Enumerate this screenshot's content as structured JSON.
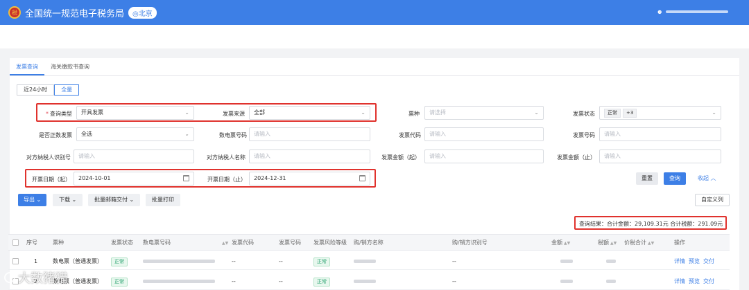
{
  "header": {
    "logo_label": "税",
    "title": "全国统一规范电子税务局",
    "region": "◎北京",
    "user_icon": "user-icon"
  },
  "tabs": [
    {
      "label": "发票查询",
      "active": true
    },
    {
      "label": "海关缴款书查询",
      "active": false
    }
  ],
  "time_range": [
    {
      "label": "近24小时",
      "active": false
    },
    {
      "label": "全量",
      "active": true
    }
  ],
  "form": {
    "query_type": {
      "label": "查询类型",
      "value": "开具发票"
    },
    "invoice_source": {
      "label": "发票来源",
      "value": "全部"
    },
    "ticket_kind": {
      "label": "票种",
      "placeholder": "请选择"
    },
    "invoice_status": {
      "label": "发票状态",
      "tag": "正常",
      "more": "+3"
    },
    "is_positive": {
      "label": "是否正数发票",
      "value": "全选"
    },
    "digital_invoice_no": {
      "label": "数电票号码",
      "placeholder": "请输入"
    },
    "invoice_code": {
      "label": "发票代码",
      "placeholder": "请输入"
    },
    "invoice_no": {
      "label": "发票号码",
      "placeholder": "请输入"
    },
    "counterparty_id": {
      "label": "对方纳税人识别号",
      "placeholder": "请输入"
    },
    "counterparty_name": {
      "label": "对方纳税人名称",
      "placeholder": "请输入"
    },
    "amount_from": {
      "label": "发票金额（起）",
      "placeholder": "请输入"
    },
    "amount_to": {
      "label": "发票金额（止）",
      "placeholder": "请输入"
    },
    "date_from": {
      "label": "开票日期（起）",
      "value": "2024-10-01"
    },
    "date_to": {
      "label": "开票日期（止）",
      "value": "2024-12-31"
    }
  },
  "actions": {
    "reset": "重置",
    "query": "查询",
    "collapse": "收起 ︿"
  },
  "toolbar": {
    "export": "导出 ⌄",
    "download": "下载 ⌄",
    "batch_mail": "批量邮箱交付 ⌄",
    "batch_print": "批量打印",
    "custom_columns": "自定义列"
  },
  "summary": {
    "text": "查询结果：合计金额：29,109.31元   合计税额：291.09元"
  },
  "table": {
    "headers": {
      "seq": "序号",
      "kind": "票种",
      "status": "发票状态",
      "digital_no": "数电票号码",
      "code": "发票代码",
      "number": "发票号码",
      "risk": "发票风险等级",
      "party_name": "购/销方名称",
      "party_id": "购/销方识别号",
      "amount": "金额",
      "tax": "税额",
      "total": "价税合计",
      "ops": "操作"
    },
    "rows": [
      {
        "seq": "1",
        "kind": "数电票（普通发票）",
        "status": "正常",
        "code": "--",
        "number": "--",
        "risk": "正常",
        "party_id": "--",
        "ops": [
          "详情",
          "预览",
          "交付"
        ]
      },
      {
        "seq": "2",
        "kind": "数电票（普通发票）",
        "status": "正常",
        "code": "--",
        "number": "--",
        "risk": "正常",
        "party_id": "--",
        "ops": [
          "详情",
          "预览",
          "交付"
        ]
      }
    ]
  },
  "watermark": "大数猪猎"
}
